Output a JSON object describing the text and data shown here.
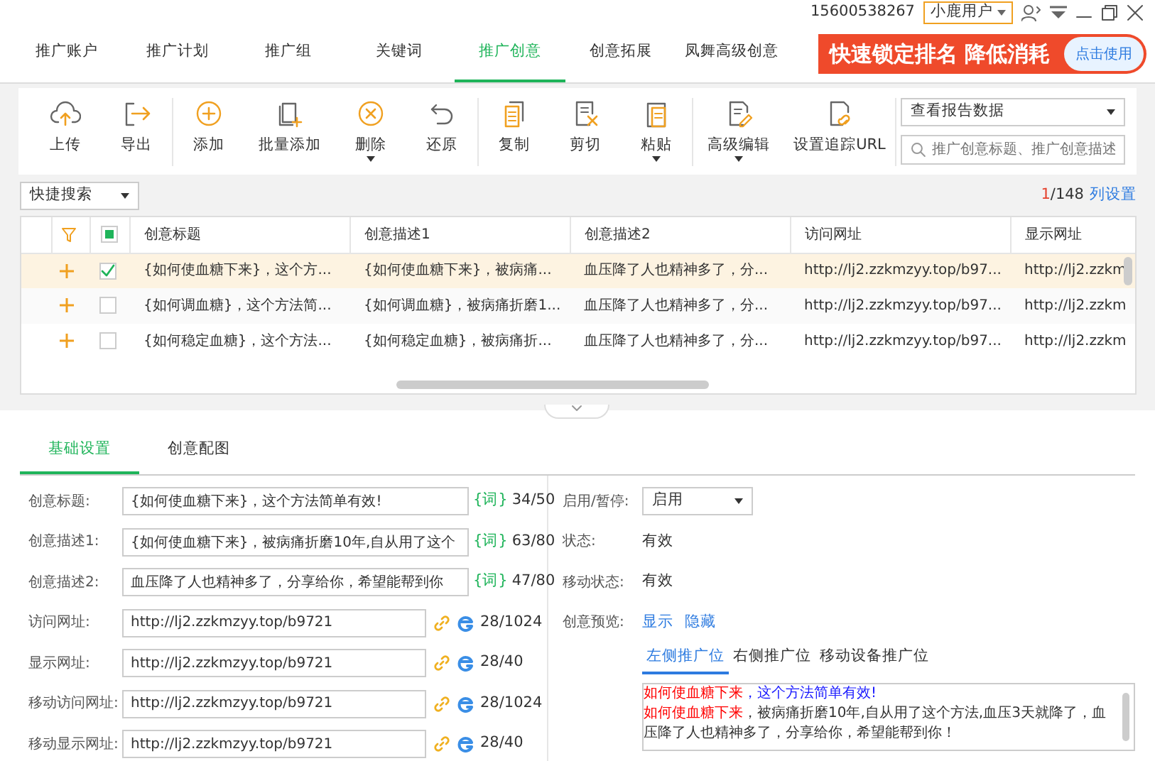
{
  "title_bar": {
    "phone": "15600538267",
    "user": "小鹿用户"
  },
  "nav_tabs": [
    {
      "label": "推广账户",
      "selected": false
    },
    {
      "label": "推广计划",
      "selected": false
    },
    {
      "label": "推广组",
      "selected": false
    },
    {
      "label": "关键词",
      "selected": false
    },
    {
      "label": "推广创意",
      "selected": true
    },
    {
      "label": "创意拓展",
      "selected": false
    },
    {
      "label": "凤舞高级创意",
      "selected": false
    }
  ],
  "promo": {
    "text": "快速锁定排名 降低消耗",
    "button": "点击使用"
  },
  "toolbar": {
    "groups": [
      [
        {
          "label": "上传",
          "kind": "upload",
          "dropdown": false
        },
        {
          "label": "导出",
          "kind": "export",
          "dropdown": false
        }
      ],
      [
        {
          "label": "添加",
          "kind": "add",
          "dropdown": false
        },
        {
          "label": "批量添加",
          "kind": "batch-add",
          "dropdown": false
        },
        {
          "label": "删除",
          "kind": "delete",
          "dropdown": true
        },
        {
          "label": "还原",
          "kind": "restore",
          "dropdown": false
        }
      ],
      [
        {
          "label": "复制",
          "kind": "copy",
          "dropdown": false
        },
        {
          "label": "剪切",
          "kind": "cut",
          "dropdown": false
        },
        {
          "label": "粘贴",
          "kind": "paste",
          "dropdown": true
        }
      ],
      [
        {
          "label": "高级编辑",
          "kind": "edit",
          "dropdown": true
        },
        {
          "label": "设置追踪URL",
          "kind": "link",
          "dropdown": false
        }
      ]
    ],
    "report_select": "查看报告数据",
    "search": {
      "placeholder": "推广创意标题、推广创意描述"
    }
  },
  "filter_bar": {
    "quick_search": "快捷搜索",
    "page_current": "1",
    "page_total": "/148",
    "column_settings": "列设置"
  },
  "table": {
    "select_all_checked": true,
    "columns": [
      "创意标题",
      "创意描述1",
      "创意描述2",
      "访问网址",
      "显示网址"
    ],
    "rows": [
      {
        "selected": true,
        "checked": true,
        "cells": [
          "{如何使血糖下来}，这个方...",
          "{如何使血糖下来}，被病痛...",
          "血压降了人也精神多了，分...",
          "http://lj2.zzkmzyy.top/b97...",
          "http://lj2.zzkm"
        ]
      },
      {
        "selected": false,
        "checked": false,
        "cells": [
          "{如何调血糖}，这个方法简...",
          "{如何调血糖}，被病痛折磨1...",
          "血压降了人也精神多了，分...",
          "http://lj2.zzkmzyy.top/b97...",
          "http://lj2.zzkm"
        ]
      },
      {
        "selected": false,
        "checked": false,
        "cells": [
          "{如何稳定血糖}，这个方法...",
          "{如何稳定血糖}，被病痛折...",
          "血压降了人也精神多了，分...",
          "http://lj2.zzkmzyy.top/b97...",
          "http://lj2.zzkm"
        ]
      }
    ]
  },
  "detail_tabs": [
    {
      "label": "基础设置",
      "selected": true
    },
    {
      "label": "创意配图",
      "selected": false
    }
  ],
  "form_fields": [
    {
      "label": "创意标题:",
      "value": "{如何使血糖下来}，这个方法简单有效!",
      "kind": "text",
      "tag": "{词}",
      "count": "34/50"
    },
    {
      "label": "创意描述1:",
      "value": "{如何使血糖下来}，被病痛折磨10年,自从用了这个",
      "kind": "text",
      "tag": "{词}",
      "count": "63/80"
    },
    {
      "label": "创意描述2:",
      "value": "血压降了人也精神多了，分享给你，希望能帮到你",
      "kind": "text",
      "tag": "{词}",
      "count": "47/80"
    },
    {
      "label": "访问网址:",
      "value": "http://lj2.zzkmzyy.top/b9721",
      "kind": "url",
      "count": "28/1024"
    },
    {
      "label": "显示网址:",
      "value": "http://lj2.zzkmzyy.top/b9721",
      "kind": "url",
      "count": "28/40"
    },
    {
      "label": "移动访问网址:",
      "value": "http://lj2.zzkmzyy.top/b9721",
      "kind": "url",
      "count": "28/1024"
    },
    {
      "label": "移动显示网址:",
      "value": "http://lj2.zzkmzyy.top/b9721",
      "kind": "url",
      "count": "28/40"
    }
  ],
  "status_select": {
    "label": "启用/暂停:",
    "value": "启用"
  },
  "info_rows": [
    {
      "label": "状态:",
      "value": "有效"
    },
    {
      "label": "移动状态:",
      "value": "有效"
    }
  ],
  "preview": {
    "label": "创意预览:",
    "links": [
      "显示",
      "隐藏"
    ],
    "tabs": [
      {
        "label": "左侧推广位",
        "selected": true
      },
      {
        "label": "右侧推广位",
        "selected": false
      },
      {
        "label": "移动设备推广位",
        "selected": false
      }
    ],
    "lines": [
      [
        {
          "text": "如何使血糖下来",
          "kind": "keyword"
        },
        {
          "text": "，这个方法简单有效!",
          "kind": "title"
        }
      ],
      [
        {
          "text": "如何使血糖下来",
          "kind": "keyword"
        },
        {
          "text": "，被病痛折磨10年,自从用了这个方法,血压3天就降了，血压降了人也精神多了，分享给你，希望能帮到你！",
          "kind": "plain"
        }
      ]
    ]
  }
}
